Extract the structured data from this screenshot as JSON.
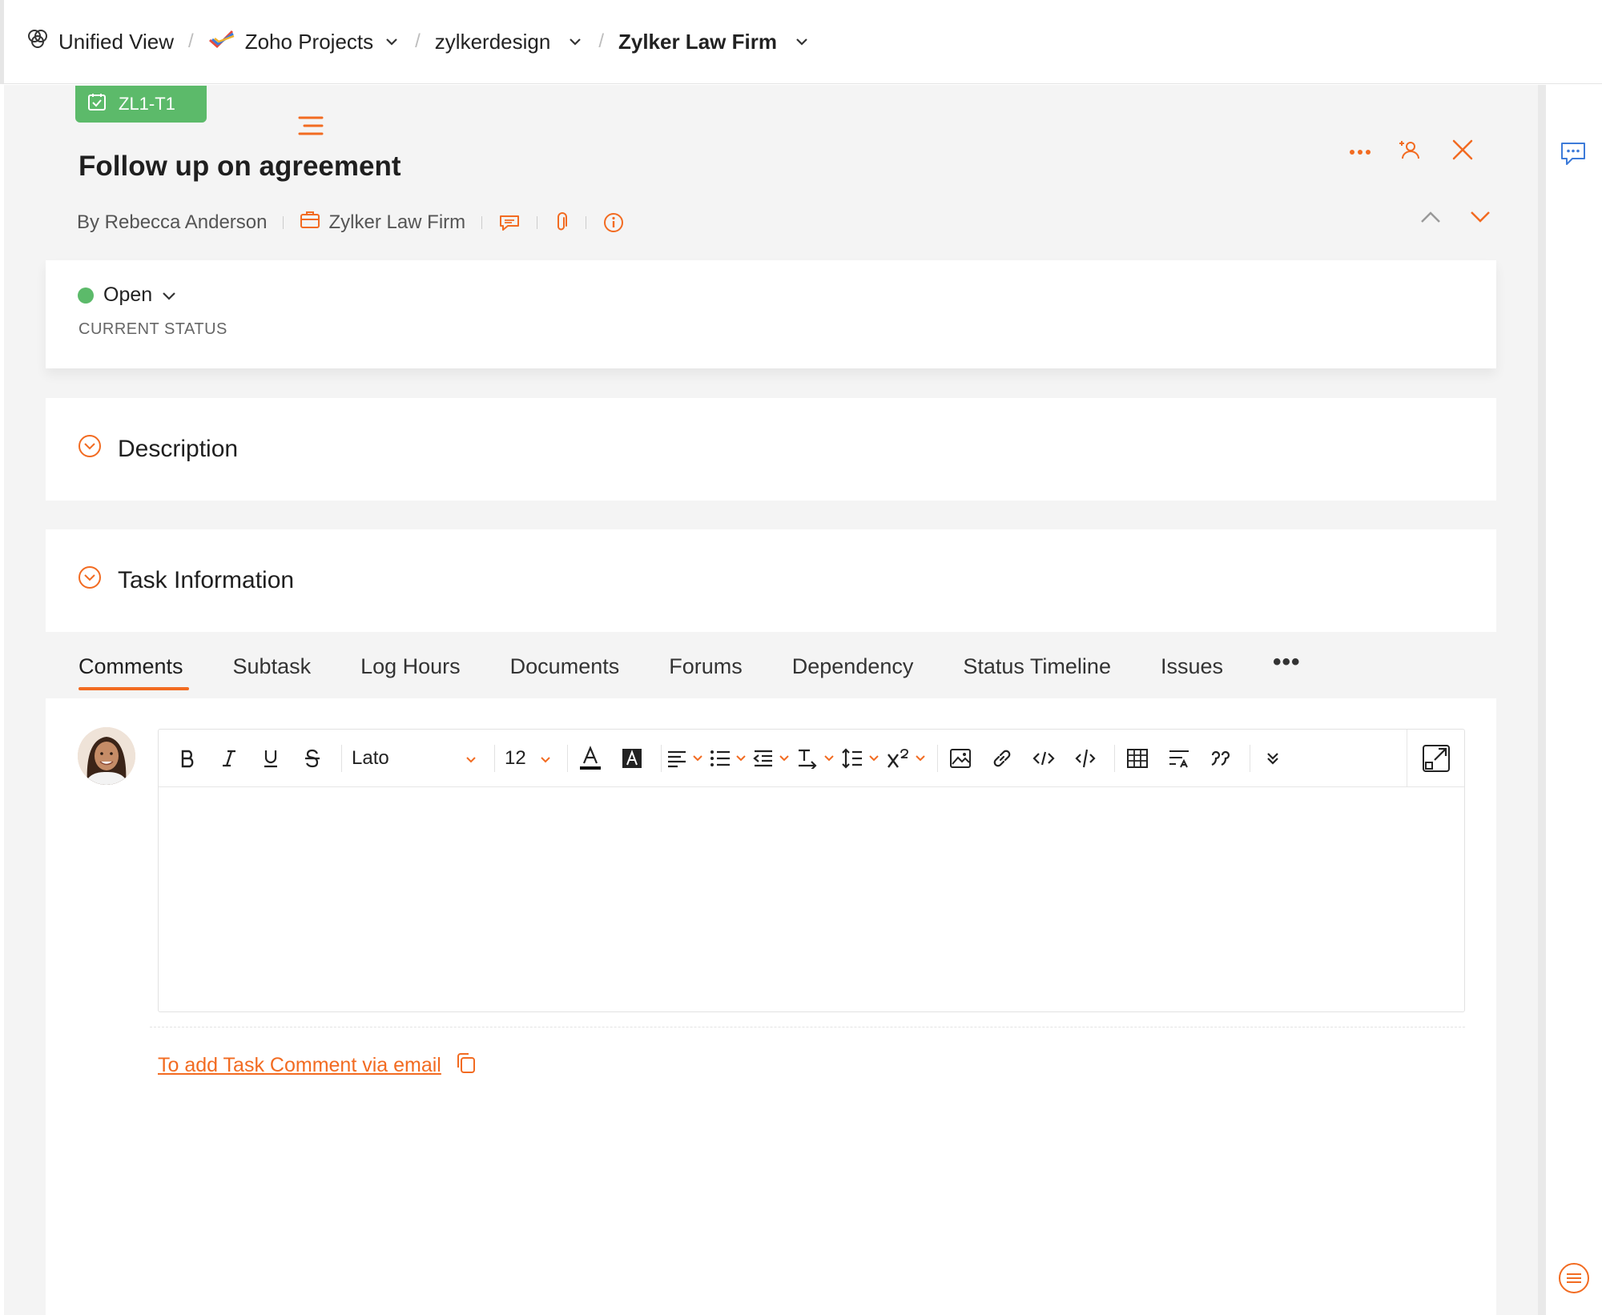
{
  "breadcrumb": {
    "items": [
      {
        "label": "Unified View",
        "icon": "unified-view-icon"
      },
      {
        "label": "Zoho Projects",
        "icon": "zoho-projects-check-icon",
        "dropdown": true
      },
      {
        "label": "zylkerdesign",
        "dropdown": true
      },
      {
        "label": "Zylker Law Firm",
        "dropdown": true,
        "active": true
      }
    ]
  },
  "task": {
    "id": "ZL1-T1",
    "title": "Follow up on agreement",
    "author": "By Rebecca Anderson",
    "project": "Zylker Law Firm",
    "status": "Open",
    "status_label": "CURRENT STATUS",
    "status_color": "#5cba6a"
  },
  "sections": {
    "description": "Description",
    "task_information": "Task Information"
  },
  "tabs": [
    "Comments",
    "Subtask",
    "Log Hours",
    "Documents",
    "Forums",
    "Dependency",
    "Status Timeline",
    "Issues"
  ],
  "tabs_more": "•••",
  "active_tab": "Comments",
  "editor": {
    "font": "Lato",
    "size": "12"
  },
  "email_link": "To add Task Comment via email",
  "colors": {
    "accent": "#f26b21",
    "status_green": "#5cba6a",
    "info_blue": "#3d7bd9"
  }
}
